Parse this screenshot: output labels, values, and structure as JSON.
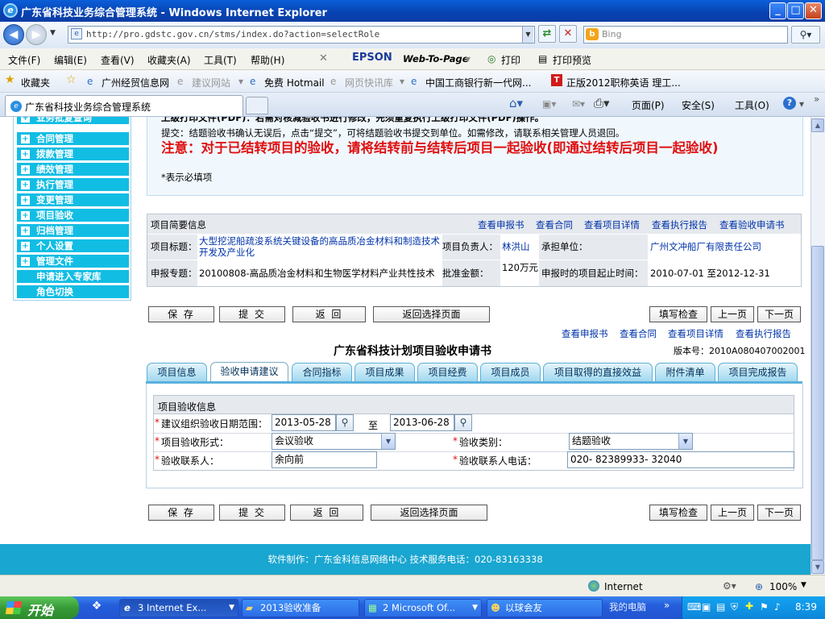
{
  "window": {
    "title": "广东省科技业务综合管理系统 - Windows Internet Explorer",
    "controls": {
      "minimize": "_",
      "maximize": "□",
      "close": "✕"
    }
  },
  "browser": {
    "address": "http://pro.gdstc.gov.cn/stms/index.do?action=selectRole",
    "search_placeholder": "Bing",
    "menu": [
      "文件(F)",
      "编辑(E)",
      "查看(V)",
      "收藏夹(A)",
      "工具(T)",
      "帮助(H)"
    ],
    "epson": {
      "brand": "EPSON",
      "product": "Web-To-Page",
      "print": "打印",
      "preview": "打印预览"
    },
    "favorites_label": "收藏夹",
    "favorites": [
      {
        "label": "广州经贸信息网",
        "gray": false
      },
      {
        "label": "建议网站",
        "gray": true
      },
      {
        "label": "免费 Hotmail",
        "gray": false
      },
      {
        "label": "网页快讯库",
        "gray": true
      },
      {
        "label": "中国工商银行新一代网...",
        "gray": false
      },
      {
        "label": "正版2012职称英语 理工...",
        "gray": false
      }
    ],
    "tab_title": "广东省科技业务综合管理系统",
    "commands": {
      "page": "页面(P)",
      "safety": "安全(S)",
      "tools": "工具(O)"
    }
  },
  "sidebar": {
    "items": [
      "业务批复查询",
      "合同管理",
      "拨款管理",
      "绩效管理",
      "执行管理",
      "变更管理",
      "项目验收",
      "归档管理",
      "个人设置",
      "管理文件"
    ],
    "subitems": [
      "申请进入专家库",
      "角色切换"
    ]
  },
  "notice": {
    "line1": "上级打印文件(PDF)：若需对核减验收书进行修改，先须重复执行上级打印文件(PDF)操作。",
    "line2": "提交：结题验收书确认无误后，点击“提交”，可将结题验收书提交到单位。如需修改，请联系相关管理人员退回。",
    "warning": "注意：对于已结转项目的验收，请将结转前与结转后项目一起验收(即通过结转后项目一起验收)",
    "required": "*表示必填项"
  },
  "summary": {
    "header": "项目简要信息",
    "links": [
      "查看申报书",
      "查看合同",
      "查看项目详情",
      "查看执行报告",
      "查看验收申请书"
    ],
    "title_label": "项目标题：",
    "title_value": "大型挖泥船疏浚系统关键设备的高品质冶金材料和制造技术开发及产业化",
    "leader_label": "项目负责人：",
    "leader_value": "林洪山",
    "unit_label": "承担单位：",
    "unit_value": "广州文冲船厂有限责任公司",
    "topic_label": "申报专题：",
    "topic_value": "20100808-高品质冶金材料和生物医学材料产业共性技术",
    "amount_label": "批准金额：",
    "amount_value": "120万元",
    "period_label": "申报时的项目起止时间：",
    "period_value": "2010-07-01 至2012-12-31"
  },
  "toolbar": {
    "save": "保 存",
    "submit": "提 交",
    "back": "返 回",
    "back_select": "返回选择页面",
    "check": "填写检查",
    "prev": "上一页",
    "next": "下一页"
  },
  "doc": {
    "links": [
      "查看申报书",
      "查看合同",
      "查看项目详情",
      "查看执行报告"
    ],
    "title": "广东省科技计划项目验收申请书",
    "version": "版本号：2010A080407002001"
  },
  "tabs": [
    "项目信息",
    "验收申请建议",
    "合同指标",
    "项目成果",
    "项目经费",
    "项目成员",
    "项目取得的直接效益",
    "附件清单",
    "项目完成报告"
  ],
  "form": {
    "section": "项目验收信息",
    "date_label": "建议组织验收日期范围：",
    "date_from": "2013-05-28",
    "date_to_label": "至",
    "date_to": "2013-06-28",
    "form_label": "项目验收形式：",
    "form_value": "会议验收",
    "type_label": "验收类别：",
    "type_value": "结题验收",
    "contact_label": "验收联系人：",
    "contact_value": "余向前",
    "phone_label": "验收联系人电话：",
    "phone_value": "020- 82389933- 32040",
    "required_mark": "*"
  },
  "footer": {
    "text": "软件制作：广东金科信息网络中心     技术服务电话：020-83163338"
  },
  "status": {
    "zone": "Internet",
    "zoom": "100%"
  },
  "taskbar": {
    "start": "开始",
    "items": [
      "3 Internet Ex...",
      "2013验收准备",
      "2 Microsoft Of...",
      "以球会友"
    ],
    "mycomputer": "我的电脑",
    "clock": "8:39"
  }
}
